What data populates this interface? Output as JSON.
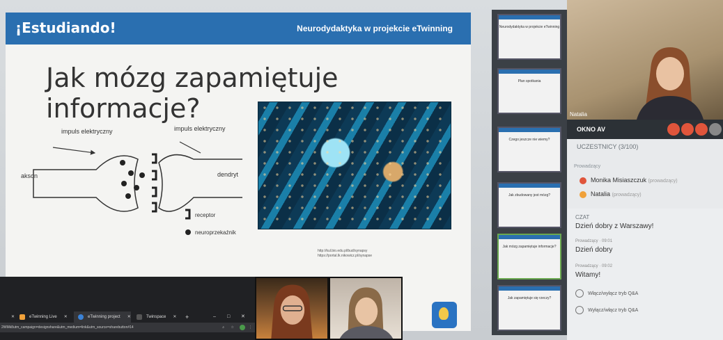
{
  "slide": {
    "brand": "¡Estudiando!",
    "subtitle": "Neurodydaktyka w projekcie eTwinning",
    "title": "Jak mózg zapamiętuje informacje?",
    "diagram": {
      "impulse_left": "impuls elektryczny",
      "impulse_right": "impuls elektryczny",
      "axon": "akson",
      "dendrite": "dendryt",
      "receptor": "receptor",
      "neurotransmitter": "neuroprzekaźnik"
    },
    "credit_lines": [
      "http://kul.bio.edu.pl/bud/synapsy",
      "https://portal.lk.nikowicz.pl/synapse"
    ]
  },
  "thumbnails": [
    {
      "title": "Neurodydaktyka w projekcie eTwinning"
    },
    {
      "title": "Plan spotkania"
    },
    {
      "title": "Czego jeszcze nie wiemy?"
    },
    {
      "title": "Jak zbudowany jest mózg?"
    },
    {
      "title": "Jak mózg zapamiętuje informacje?"
    },
    {
      "title": "Jak zapamiętuje się rzeczy?"
    }
  ],
  "panel": {
    "cam_name": "Natalia",
    "av_label": "OKNO AV",
    "participants_label": "UCZESTNICY (3/100)",
    "presenters_label": "Prowadzący",
    "participants": [
      {
        "name": "Monika Misiaszczuk",
        "role": "(prowadzący)",
        "color": "#e0553b"
      },
      {
        "name": "Natalia",
        "role": "(prowadzący)",
        "color": "#f0a13a"
      }
    ],
    "chat_label": "CZAT",
    "chat": [
      {
        "meta": "",
        "text": "Dzień dobry z Warszawy!"
      },
      {
        "meta": "Prowadzący · 09:01",
        "text": "Dzień dobry"
      },
      {
        "meta": "Prowadzący · 09:02",
        "text": "Witamy!"
      }
    ],
    "qa": [
      "Włącz/wyłącz tryb Q&A",
      "Wyłącz/włącz tryb Q&A"
    ]
  },
  "browser": {
    "tabs": [
      {
        "label": "",
        "color": "#888"
      },
      {
        "label": "eTwinning Live",
        "color": "#f0a13a"
      },
      {
        "label": "eTwinning project",
        "color": "#3b82d6"
      },
      {
        "label": "Twinspace",
        "color": "#333"
      }
    ],
    "new_tab": "+",
    "window_controls": [
      "–",
      "□",
      "✕"
    ],
    "url": "2WMk8utm_campaign=designshare&utm_medium=link&utm_source=sharebutton#14"
  },
  "colors": {
    "brand_bar": "#2a6fb0",
    "accent": "#e0553b"
  }
}
